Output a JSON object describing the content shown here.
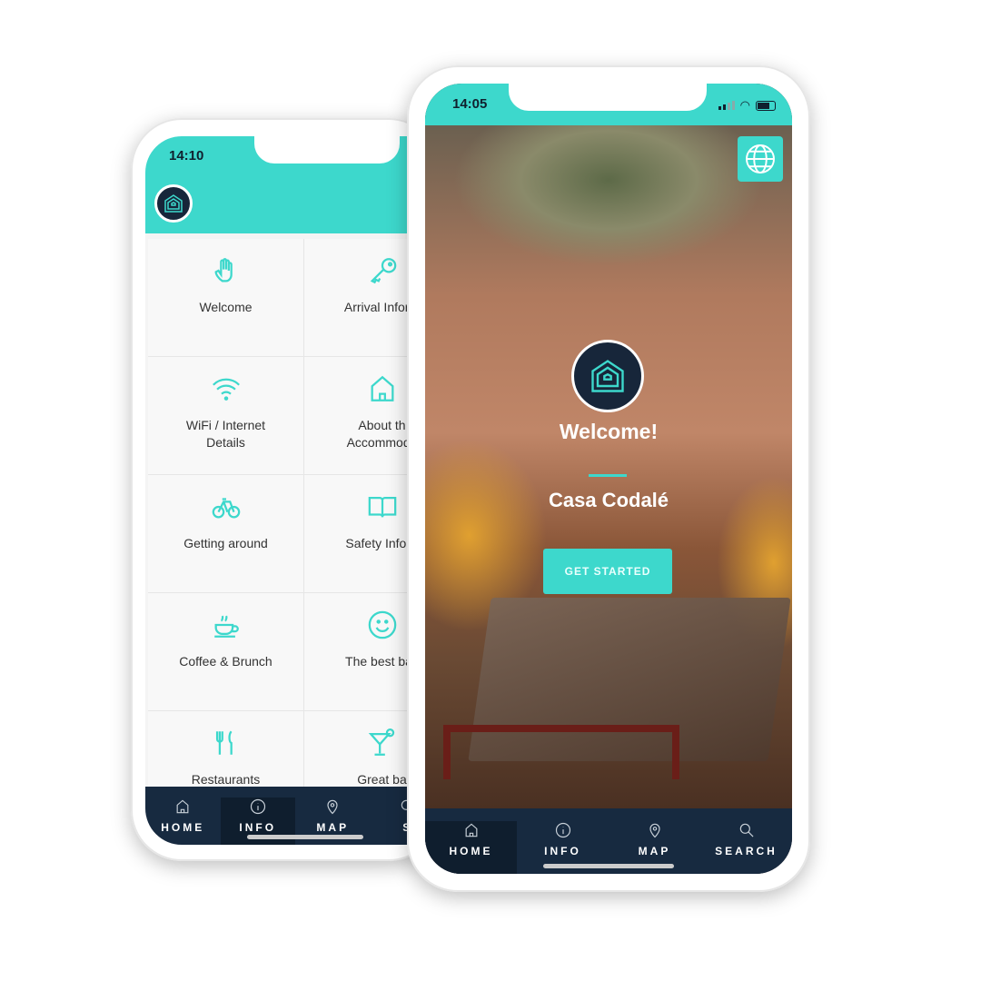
{
  "back_phone": {
    "time": "14:10",
    "grid": [
      {
        "icon": "hand-icon",
        "label": "Welcome"
      },
      {
        "icon": "key-icon",
        "label": "Arrival Inform"
      },
      {
        "icon": "wifi-icon",
        "label": "WiFi / Internet\nDetails"
      },
      {
        "icon": "house-icon",
        "label": "About th\nAccommoda"
      },
      {
        "icon": "bicycle-icon",
        "label": "Getting around"
      },
      {
        "icon": "book-icon",
        "label": "Safety Info &"
      },
      {
        "icon": "coffee-icon",
        "label": "Coffee & Brunch"
      },
      {
        "icon": "smiley-icon",
        "label": "The best bak"
      },
      {
        "icon": "fork-knife-icon",
        "label": "Restaurants"
      },
      {
        "icon": "cocktail-icon",
        "label": "Great ba"
      }
    ],
    "tabs": [
      {
        "label": "HOME"
      },
      {
        "label": "INFO",
        "active": true
      },
      {
        "label": "MAP"
      },
      {
        "label": "S"
      }
    ]
  },
  "front_phone": {
    "time": "14:05",
    "welcome": "Welcome!",
    "property_name": "Casa Codalé",
    "cta": "GET STARTED",
    "tabs": [
      {
        "label": "HOME",
        "active": true
      },
      {
        "label": "INFO"
      },
      {
        "label": "MAP"
      },
      {
        "label": "SEARCH"
      }
    ]
  },
  "colors": {
    "accent": "#3dd8cc",
    "navy": "#172a40"
  }
}
